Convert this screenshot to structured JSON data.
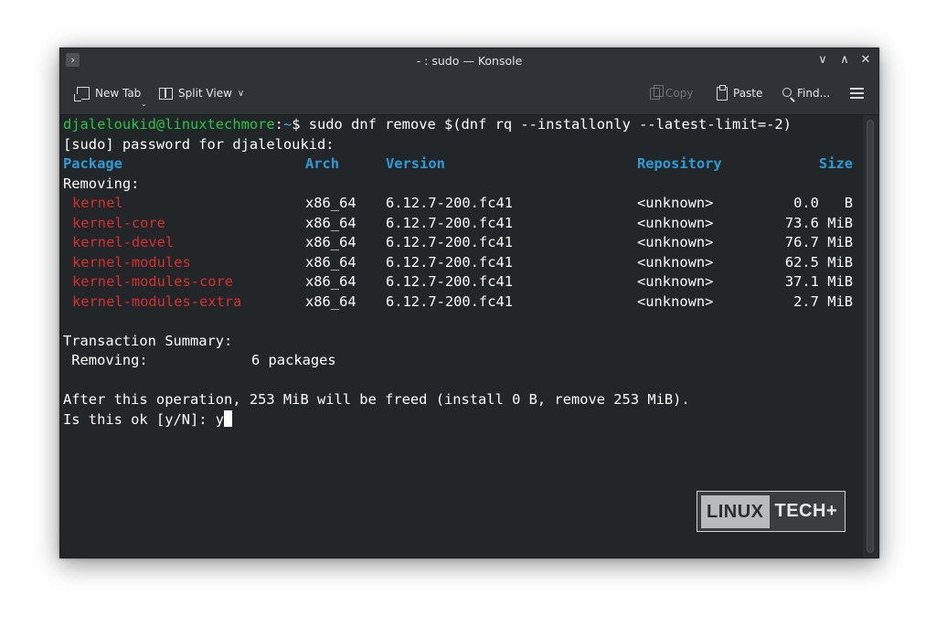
{
  "window": {
    "title": "- : sudo — Konsole",
    "app_icon_glyph": "›",
    "controls": {
      "minimize": "∨",
      "maximize": "∧",
      "close": "✕"
    }
  },
  "toolbar": {
    "new_tab": "New Tab",
    "split_view": "Split View",
    "split_chevron": "∨",
    "copy": "Copy",
    "paste": "Paste",
    "find": "Find..."
  },
  "terminal": {
    "prompt_user": "djaleloukid@linuxtechmore",
    "prompt_sep": ":",
    "prompt_dir": "~",
    "prompt_command": "$ sudo dnf remove $(dnf rq --installonly --latest-limit=-2)",
    "sudo_prompt": "[sudo] password for djaleloukid:",
    "headers": {
      "package": "Package",
      "arch": "Arch",
      "version": "Version",
      "repository": "Repository",
      "size": "Size"
    },
    "removing_label": "Removing:",
    "packages": [
      {
        "name": "kernel",
        "arch": "x86_64",
        "version": "6.12.7-200.fc41",
        "repo": "<unknown>",
        "size": "0.0   B"
      },
      {
        "name": "kernel-core",
        "arch": "x86_64",
        "version": "6.12.7-200.fc41",
        "repo": "<unknown>",
        "size": "73.6 MiB"
      },
      {
        "name": "kernel-devel",
        "arch": "x86_64",
        "version": "6.12.7-200.fc41",
        "repo": "<unknown>",
        "size": "76.7 MiB"
      },
      {
        "name": "kernel-modules",
        "arch": "x86_64",
        "version": "6.12.7-200.fc41",
        "repo": "<unknown>",
        "size": "62.5 MiB"
      },
      {
        "name": "kernel-modules-core",
        "arch": "x86_64",
        "version": "6.12.7-200.fc41",
        "repo": "<unknown>",
        "size": "37.1 MiB"
      },
      {
        "name": "kernel-modules-extra",
        "arch": "x86_64",
        "version": "6.12.7-200.fc41",
        "repo": "<unknown>",
        "size": "2.7 MiB"
      }
    ],
    "summary_title": "Transaction Summary:",
    "summary_label": " Removing:",
    "summary_value": "6 packages",
    "operation_line": "After this operation, 253 MiB will be freed (install 0 B, remove 253 MiB).",
    "confirm_line": "Is this ok [y/N]: y"
  },
  "watermark": {
    "left": "LINUX",
    "right": "TECH+"
  },
  "colors": {
    "background": "#232629",
    "user": "#27c549",
    "directory": "#3daee9",
    "header": "#2e9bd6",
    "package_name": "#d62f2f",
    "text": "#fcfcfc"
  }
}
